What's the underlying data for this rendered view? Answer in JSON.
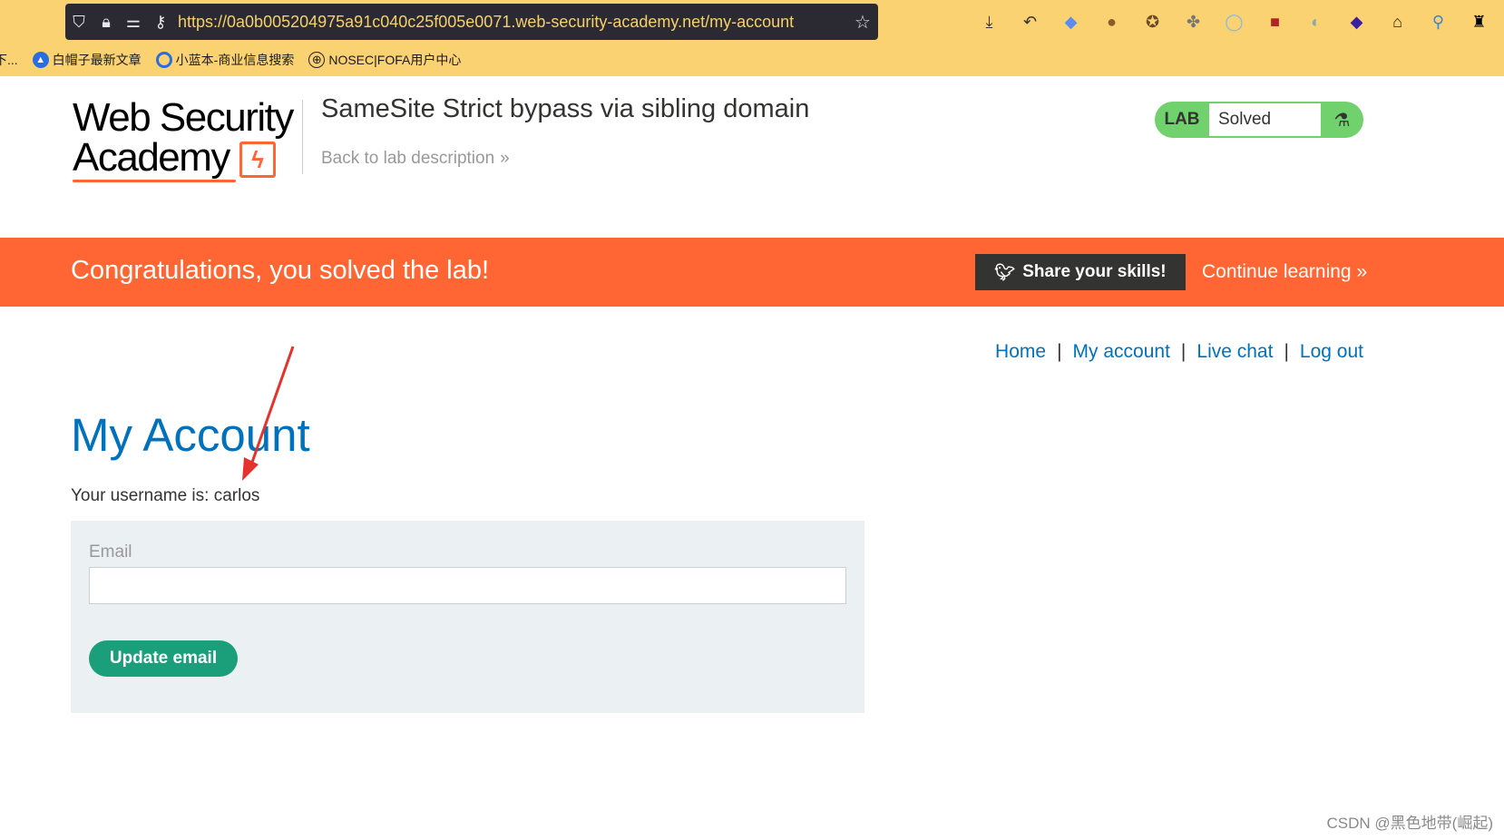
{
  "browser": {
    "url": "https://0a0b005204975a91c040c25f005e0071.web-security-academy.net/my-account",
    "bookmarks": [
      {
        "label": "下...",
        "icon": "page-icon"
      },
      {
        "label": "白帽子最新文章",
        "icon": "whitehat-icon"
      },
      {
        "label": "小蓝本-商业信息搜索",
        "icon": "xiaolanben-icon"
      },
      {
        "label": "NOSEC|FOFA用户中心",
        "icon": "globe-icon"
      }
    ]
  },
  "header": {
    "logo_line1": "Web Security",
    "logo_line2": "Academy",
    "lab_title": "SameSite Strict bypass via sibling domain",
    "back_link": "Back to lab description",
    "lab_badge": "LAB",
    "lab_status": "Solved"
  },
  "banner": {
    "message": "Congratulations, you solved the lab!",
    "share_label": "Share your skills!",
    "continue_label": "Continue learning"
  },
  "nav": {
    "home": "Home",
    "my_account": "My account",
    "live_chat": "Live chat",
    "log_out": "Log out"
  },
  "content": {
    "heading": "My Account",
    "username_text": "Your username is: carlos",
    "email_label": "Email",
    "email_value": "",
    "update_button": "Update email"
  },
  "watermark": "CSDN @黑色地带(崛起)",
  "colors": {
    "chrome": "#fbd271",
    "banner": "#ff6633",
    "link": "#0071bc",
    "lab_solved": "#70d16d",
    "button": "#1b9e7a",
    "annotation": "#e5322d"
  }
}
